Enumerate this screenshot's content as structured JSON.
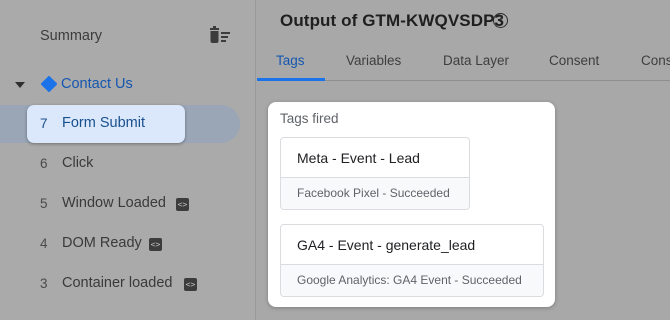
{
  "sidebar": {
    "summary_label": "Summary",
    "container": {
      "label": "Contact Us"
    },
    "events": [
      {
        "number": "7",
        "label": "Form Submit",
        "has_code_icon": false,
        "active": true
      },
      {
        "number": "6",
        "label": "Click",
        "has_code_icon": false
      },
      {
        "number": "5",
        "label": "Window Loaded",
        "has_code_icon": true
      },
      {
        "number": "4",
        "label": "DOM Ready",
        "has_code_icon": true
      },
      {
        "number": "3",
        "label": "Container loaded",
        "has_code_icon": true
      }
    ]
  },
  "main": {
    "title": "Output of GTM-KWQVSDP3",
    "tabs": [
      {
        "label": "Tags",
        "active": true
      },
      {
        "label": "Variables"
      },
      {
        "label": "Data Layer"
      },
      {
        "label": "Consent"
      },
      {
        "label": "Cons"
      }
    ],
    "panel_title": "Tags fired",
    "tags": [
      {
        "name": "Meta - Event - Lead",
        "status": "Facebook Pixel - Succeeded"
      },
      {
        "name": "GA4 - Event - generate_lead",
        "status": "Google Analytics: GA4 Event - Succeeded"
      }
    ]
  },
  "icons": {
    "delete": "delete-sweep-icon",
    "chevron": "chevron-down-icon",
    "container": "diamond-icon",
    "code": "code-icon",
    "help": "help-icon"
  },
  "colors": {
    "accent": "#1a73e8",
    "active_chip": "#dbe8fb",
    "sidebar_bg": "#aaaaaa",
    "main_bg": "#a8a8a8"
  }
}
